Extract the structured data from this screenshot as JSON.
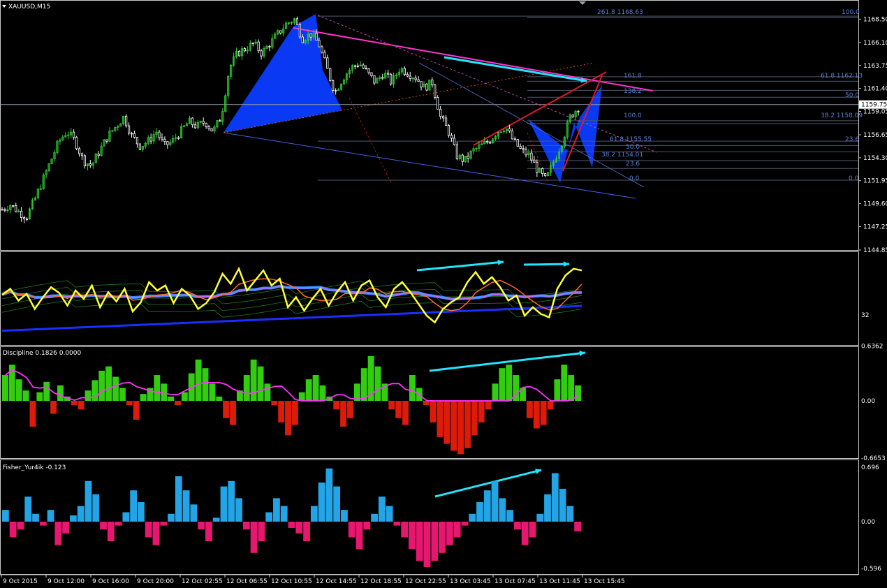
{
  "window": {
    "symbol_label": "XAUUSD,M15",
    "current_price": "1159.75"
  },
  "colors": {
    "background": "#000000",
    "frame": "#c8c8c8",
    "bull_candle": "#33cc33",
    "bear_candle": "#ffffff",
    "pattern_fill": "#0a3cff",
    "fib_text": "#5a7ed6",
    "trend_magenta": "#ff33cc",
    "trend_red": "#e0182a",
    "arrow_cyan": "#22e6ff",
    "oscillator_yellow": "#ffff33",
    "oscillator_ma_blue": "#1830ff",
    "discipline_green": "#33cc11",
    "discipline_red": "#dd1b0b",
    "discipline_ma": "#ff33ff",
    "fisher_blue": "#22a4e6",
    "fisher_pink": "#e6176e"
  },
  "chart_data": [
    {
      "type": "line",
      "title": "XAUUSD,M15",
      "y_tick_labels": [
        "1168.50",
        "1166.10",
        "1163.75",
        "1161.40",
        "1159.05",
        "1156.65",
        "1154.30",
        "1151.95",
        "1149.60",
        "1147.25",
        "1144.85"
      ],
      "ylim": [
        1144.85,
        1169.6
      ],
      "x_tick_labels": [
        "9 Oct 2015",
        "9 Oct 12:00",
        "9 Oct 16:00",
        "9 Oct 20:00",
        "12 Oct 02:55",
        "12 Oct 06:55",
        "12 Oct 10:55",
        "12 Oct 14:55",
        "12 Oct 18:55",
        "12 Oct 22:55",
        "13 Oct 03:45",
        "13 Oct 07:45",
        "13 Oct 11:45",
        "13 Oct 15:45"
      ],
      "close_path_approx": [
        1149.0,
        1149.5,
        1148.8,
        1148.2,
        1150.0,
        1152.0,
        1154.0,
        1156.0,
        1157.0,
        1156.0,
        1154.0,
        1153.5,
        1155.0,
        1156.5,
        1157.5,
        1158.5,
        1156.5,
        1155.5,
        1156.0,
        1157.0,
        1155.5,
        1156.0,
        1157.0,
        1158.0,
        1157.5,
        1158.0,
        1157.0,
        1158.5,
        1163.5,
        1165.0,
        1165.5,
        1166.0,
        1165.0,
        1166.0,
        1167.0,
        1168.0,
        1168.5,
        1166.5,
        1167.0,
        1166.0,
        1163.5,
        1161.0,
        1162.5,
        1163.5,
        1164.0,
        1163.0,
        1162.0,
        1163.0,
        1162.0,
        1163.5,
        1163.0,
        1162.5,
        1161.5,
        1162.0,
        1158.5,
        1157.0,
        1154.5,
        1154.0,
        1155.0,
        1155.5,
        1156.0,
        1157.0,
        1157.5,
        1156.0,
        1155.0,
        1154.5,
        1153.0,
        1152.0,
        1154.0,
        1156.0,
        1158.5,
        1159.5
      ],
      "fibonacci_labels": [
        "261.8  1168.63",
        "100.0",
        "161.8",
        "61.8  1162.13",
        "138.2",
        "50.0",
        "100.0",
        "38.2  1158.09",
        "23.6",
        "61.8  1155.55",
        "50.0",
        "38.2  1154.01",
        "23.6",
        "0.0",
        "0.0"
      ]
    },
    {
      "type": "line",
      "y_tick_labels": [
        "32"
      ],
      "series": [
        {
          "color": "#ffff33",
          "values": [
            0.55,
            0.62,
            0.48,
            0.56,
            0.38,
            0.52,
            0.64,
            0.57,
            0.42,
            0.6,
            0.5,
            0.66,
            0.4,
            0.58,
            0.47,
            0.62,
            0.35,
            0.46,
            0.7,
            0.6,
            0.66,
            0.45,
            0.62,
            0.54,
            0.38,
            0.45,
            0.58,
            0.8,
            0.68,
            0.86,
            0.6,
            0.72,
            0.84,
            0.66,
            0.74,
            0.4,
            0.52,
            0.36,
            0.5,
            0.62,
            0.42,
            0.58,
            0.7,
            0.48,
            0.66,
            0.72,
            0.52,
            0.4,
            0.62,
            0.7,
            0.58,
            0.44,
            0.3,
            0.22,
            0.38,
            0.46,
            0.52,
            0.7,
            0.82,
            0.68,
            0.76,
            0.64,
            0.48,
            0.54,
            0.3,
            0.4,
            0.32,
            0.28,
            0.62,
            0.78,
            0.86,
            0.84
          ]
        }
      ]
    },
    {
      "type": "bar",
      "title": "Discipline 0.1826 0.0000",
      "y_tick_labels": [
        "0.6362",
        "0.00",
        "-0.6653"
      ],
      "ylim": [
        -0.6653,
        0.6362
      ],
      "values": [
        0.3,
        0.42,
        0.25,
        0.12,
        -0.3,
        0.1,
        0.22,
        -0.15,
        0.18,
        0.05,
        -0.05,
        -0.1,
        0.12,
        0.24,
        0.35,
        0.4,
        0.28,
        0.15,
        -0.05,
        -0.22,
        0.08,
        0.15,
        0.3,
        0.2,
        0.05,
        -0.05,
        0.1,
        0.32,
        0.48,
        0.38,
        0.2,
        0.05,
        -0.2,
        -0.28,
        0.12,
        0.3,
        0.48,
        0.4,
        0.2,
        -0.05,
        -0.25,
        -0.4,
        -0.28,
        0.1,
        0.25,
        0.3,
        0.18,
        0.05,
        -0.1,
        -0.3,
        -0.2,
        0.2,
        0.38,
        0.52,
        0.4,
        0.2,
        -0.1,
        -0.2,
        -0.28,
        0.3,
        0.15,
        -0.05,
        -0.25,
        -0.42,
        -0.5,
        -0.58,
        -0.62,
        -0.55,
        -0.4,
        -0.25,
        -0.1,
        0.2,
        0.38,
        0.42,
        0.3,
        0.15,
        -0.2,
        -0.32,
        -0.28,
        -0.1,
        0.25,
        0.42,
        0.3,
        0.18
      ]
    },
    {
      "type": "bar",
      "title": "Fisher_Yur4ik -0.123",
      "y_tick_labels": [
        "0.696",
        "0.00",
        "-0.596"
      ],
      "ylim": [
        -0.596,
        0.696
      ],
      "values": [
        0.15,
        -0.2,
        -0.1,
        0.32,
        0.1,
        -0.05,
        0.15,
        -0.3,
        -0.15,
        0.08,
        0.2,
        0.52,
        0.35,
        -0.1,
        -0.25,
        -0.05,
        0.12,
        0.4,
        0.25,
        -0.2,
        -0.3,
        -0.05,
        0.1,
        0.58,
        0.4,
        0.22,
        -0.1,
        -0.25,
        0.05,
        0.45,
        0.52,
        0.3,
        -0.1,
        -0.4,
        -0.25,
        0.12,
        0.3,
        0.2,
        -0.08,
        -0.15,
        -0.25,
        0.2,
        0.5,
        0.68,
        0.45,
        0.15,
        -0.2,
        -0.35,
        -0.1,
        0.1,
        0.32,
        0.2,
        -0.05,
        -0.2,
        -0.35,
        -0.5,
        -0.58,
        -0.5,
        -0.4,
        -0.3,
        -0.2,
        -0.05,
        0.1,
        0.25,
        0.4,
        0.52,
        0.3,
        0.15,
        -0.1,
        -0.3,
        -0.2,
        0.1,
        0.35,
        0.62,
        0.42,
        0.2,
        -0.123
      ]
    }
  ]
}
